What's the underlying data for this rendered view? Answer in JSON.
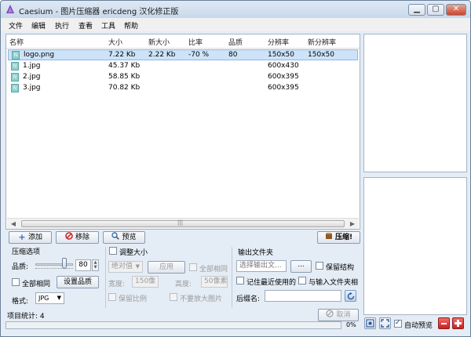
{
  "window": {
    "title": "Caesium - 图片压缩器  ericdeng 汉化修正版",
    "minimize": "▁",
    "maximize": "▢",
    "close": "✕"
  },
  "menu": [
    "文件",
    "编辑",
    "执行",
    "查看",
    "工具",
    "帮助"
  ],
  "table": {
    "headers": [
      "名称",
      "大小",
      "新大小",
      "比率",
      "品质",
      "分辨率",
      "新分辨率"
    ],
    "rows": [
      {
        "icon": "N",
        "name": "logo.png",
        "size": "7.22 Kb",
        "new_size": "2.22 Kb",
        "ratio": "-70 %",
        "quality": "80",
        "resolution": "150x50",
        "new_resolution": "150x50"
      },
      {
        "icon": "N",
        "name": "1.jpg",
        "size": "45.37 Kb",
        "new_size": "",
        "ratio": "",
        "quality": "",
        "resolution": "600x430",
        "new_resolution": ""
      },
      {
        "icon": "N",
        "name": "2.jpg",
        "size": "58.85 Kb",
        "new_size": "",
        "ratio": "",
        "quality": "",
        "resolution": "600x395",
        "new_resolution": ""
      },
      {
        "icon": "N",
        "name": "3.jpg",
        "size": "70.82 Kb",
        "new_size": "",
        "ratio": "",
        "quality": "",
        "resolution": "600x395",
        "new_resolution": ""
      }
    ],
    "scroll_grip": "|||"
  },
  "actions": {
    "add": "添加",
    "remove": "移除",
    "preview": "预览",
    "compress": "压缩!"
  },
  "compression": {
    "group_title": "压缩选项",
    "quality_label": "品质:",
    "quality_value": "80",
    "quality_level": 0.8,
    "same_for_all": "全部相同",
    "set_quality": "设置品质",
    "format_label": "格式:",
    "format_value": "JPG"
  },
  "resize": {
    "group_title": "调整大小",
    "mode_value": "绝对值",
    "apply": "应用",
    "same_for_all": "全部相同",
    "width_label": "宽度:",
    "width_value": "150像",
    "height_label": "高度:",
    "height_value": "50像素",
    "keep_ratio": "保留比例",
    "no_enlarge": "不要放大图片"
  },
  "output": {
    "group_title": "输出文件夹",
    "folder_placeholder": "选择输出文...",
    "browse": "...",
    "keep_structure": "保留结构",
    "remember_last": "记住最近使用的",
    "same_as_input": "与输入文件夹相",
    "suffix_label": "后缀名:",
    "suffix_value": ""
  },
  "status": {
    "item_count": "项目统计:  4",
    "cancel": "取消",
    "progress_text": "0%",
    "progress_value": 0,
    "auto_preview": "自动预览"
  }
}
